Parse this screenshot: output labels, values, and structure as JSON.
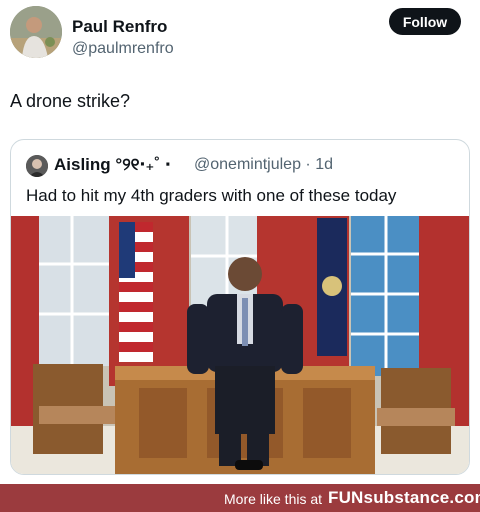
{
  "post": {
    "display_name": "Paul Renfro",
    "handle": "@paulmrenfro",
    "follow_label": "Follow",
    "text": "A drone strike?"
  },
  "quoted_post": {
    "display_name": "Aisling °୨୧‧₊˚ ⋅",
    "handle": "@onemintjulep",
    "time": "1d",
    "text": "Had to hit my 4th graders with one of these today"
  },
  "footer": {
    "prefix": "More like this at",
    "brand": "FUNsubstance.com"
  },
  "colors": {
    "follow_button": "#0f1419",
    "footer_bar": "#9b3b3e",
    "secondary_text": "#536471"
  }
}
